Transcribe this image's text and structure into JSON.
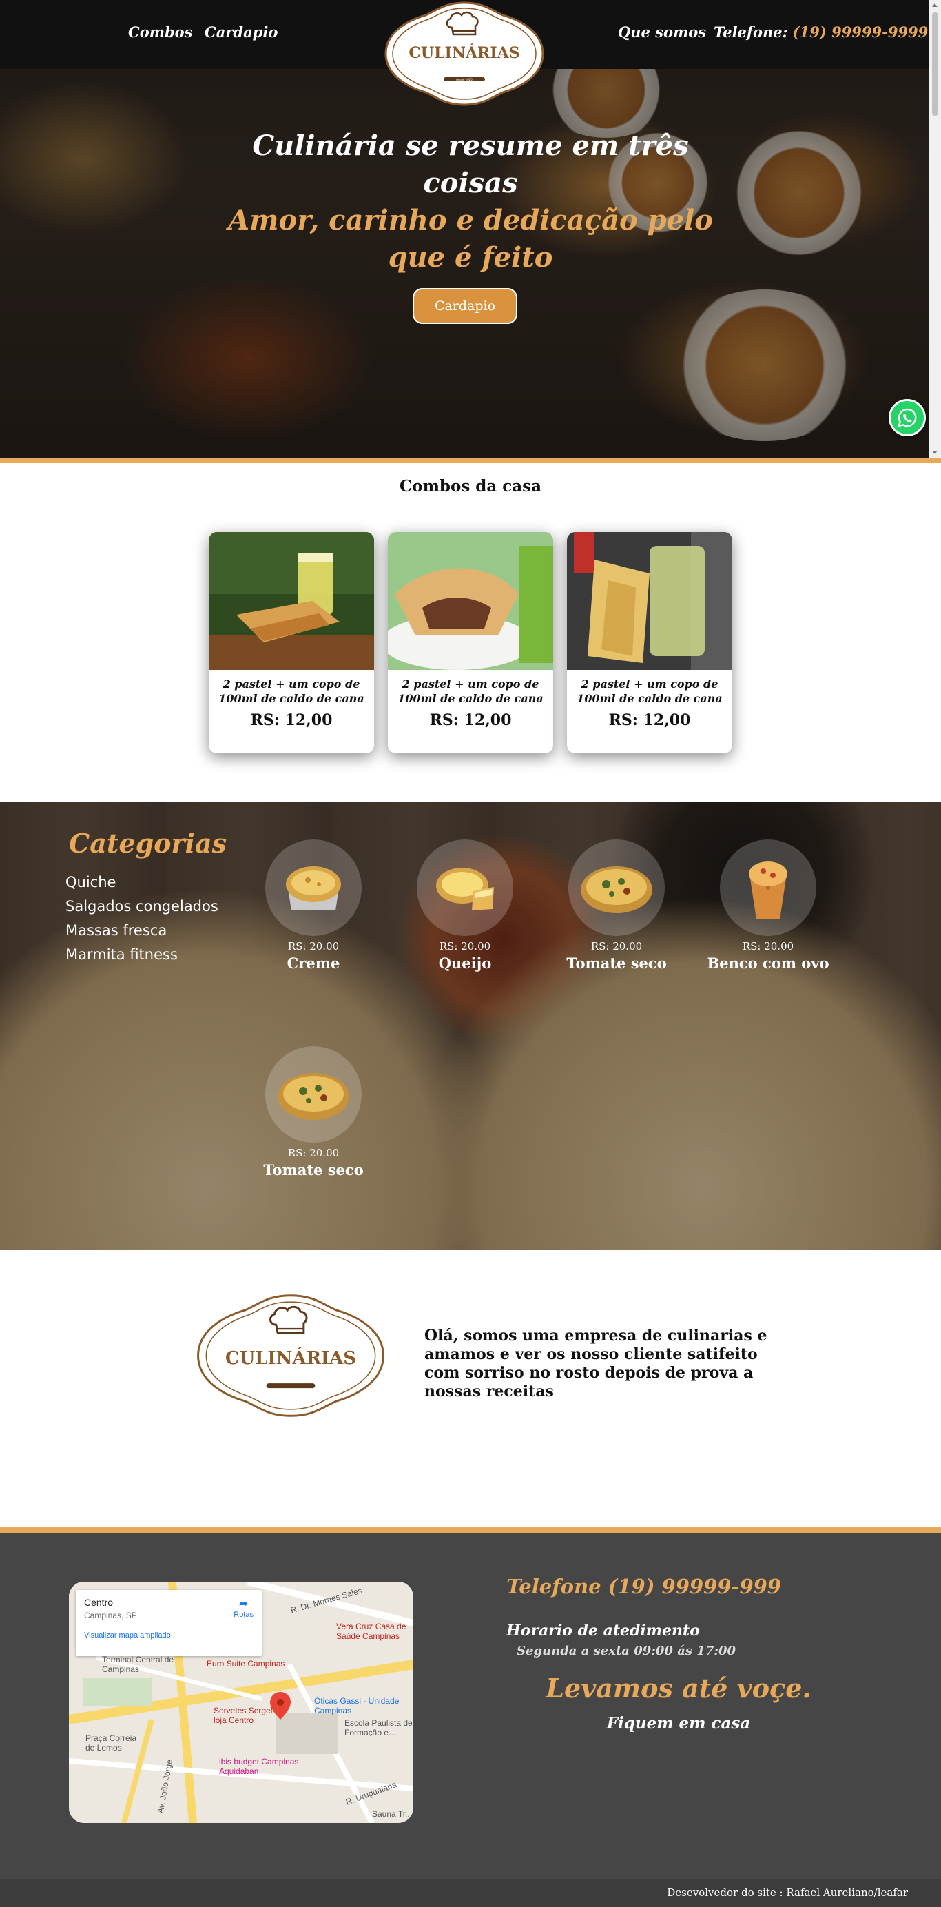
{
  "header": {
    "nav_combos": "Combos",
    "nav_cardapio": "Cardapio",
    "nav_quesomos": "Que somos",
    "phone_label": "Telefone:",
    "phone_number": "(19) 99999-9999",
    "logo_text": "CULINÁRIAS",
    "logo_sub": "desde 2020"
  },
  "hero": {
    "line1": "Culinária se resume em três coisas",
    "line2": "Amor, carinho e dedicação pelo que é feito",
    "button": "Cardapio"
  },
  "whatsapp": {
    "icon": "whatsapp-icon"
  },
  "combos": {
    "title": "Combos da casa",
    "items": [
      {
        "name": "2 pastel + um copo de 100ml de caldo de cana",
        "price": "RS: 12,00"
      },
      {
        "name": "2 pastel + um copo de 100ml de caldo de cana",
        "price": "RS: 12,00"
      },
      {
        "name": "2 pastel + um copo de 100ml de caldo de cana",
        "price": "RS: 12,00"
      }
    ]
  },
  "categorias": {
    "title": "Categorias",
    "list": [
      "Quiche",
      "Salgados congelados",
      "Massas fresca",
      "Marmita fitness"
    ],
    "products": [
      {
        "price": "RS: 20.00",
        "name": "Creme"
      },
      {
        "price": "RS: 20.00",
        "name": "Queijo"
      },
      {
        "price": "RS: 20.00",
        "name": "Tomate seco"
      },
      {
        "price": "RS: 20.00",
        "name": "Benco com ovo"
      },
      {
        "price": "RS: 20.00",
        "name": "Tomate seco"
      }
    ]
  },
  "sobre": {
    "logo_text": "CULINÁRIAS",
    "text": "Olá, somos uma empresa de culinarias e amamos e ver os nosso cliente satifeito com sorriso no rosto depois de prova a nossas receitas"
  },
  "map": {
    "place": "Centro",
    "city": "Campinas, SP",
    "link": "Visualizar mapa ampliado",
    "rotas": "Rotas",
    "labels": {
      "terminal": "Terminal Central de Campinas",
      "euro": "Euro Suite Campinas",
      "vera": "Vera Cruz Casa de Saúde Campinas",
      "sorvetes": "Sorvetes Sergel loja Centro",
      "oticas": "Óticas Gassi - Unidade Campinas",
      "escola": "Escola Paulista de Formação e...",
      "praca": "Praça Correia de Lemos",
      "ibis": "ibis budget Campinas Aquidaban",
      "rua": "R. Dr. Moraes Sales",
      "sauna": "Sauna Tr...",
      "joao": "Av. João Jorge",
      "uruguaiana": "R. Uruguaiana"
    }
  },
  "footer": {
    "phone": "Telefone (19) 99999-999",
    "hours_title": "Horario de atedimento",
    "hours": "Segunda a sexta 09:00 ás 17:00",
    "levamos": "Levamos até voçe.",
    "fiquem": "Fiquem em casa"
  },
  "bottom": {
    "dev_label": "Desevolvedor do site :",
    "dev_link": "Rafael Aureliano/leafar"
  },
  "colors": {
    "accent": "#e8a85a",
    "button": "#d9933f",
    "footer_bg": "#464646",
    "whatsapp": "#25d366"
  }
}
